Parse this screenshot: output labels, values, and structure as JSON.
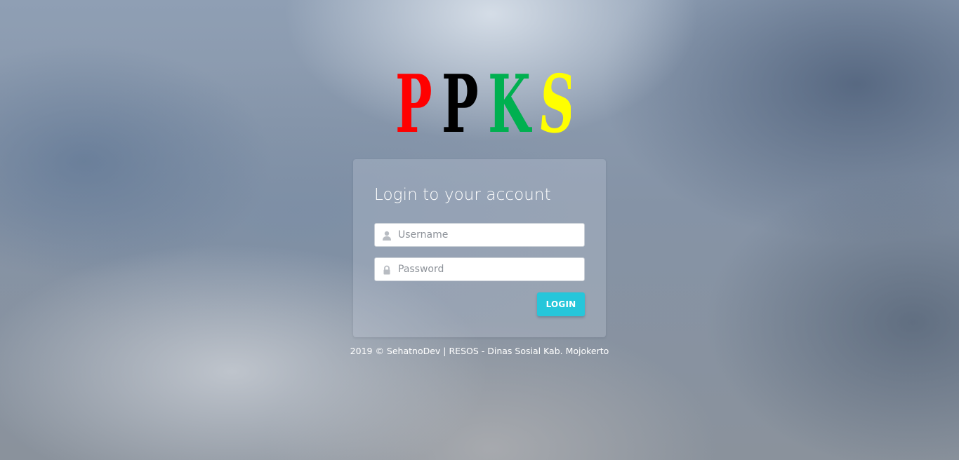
{
  "logo": {
    "letters": [
      {
        "char": "P",
        "color": "#ff0000"
      },
      {
        "char": "P",
        "color": "#000000"
      },
      {
        "char": "K",
        "color": "#00b050"
      },
      {
        "char": "S",
        "color": "#ffff00"
      }
    ]
  },
  "login": {
    "title": "Login to your account",
    "username_placeholder": "Username",
    "password_placeholder": "Password",
    "button_label": "LOGIN",
    "user_icon": "user-icon",
    "lock_icon": "lock-icon",
    "accent_color": "#26c6da"
  },
  "footer": {
    "text": "2019 © SehatnoDev | RESOS - Dinas Sosial Kab. Mojokerto"
  }
}
